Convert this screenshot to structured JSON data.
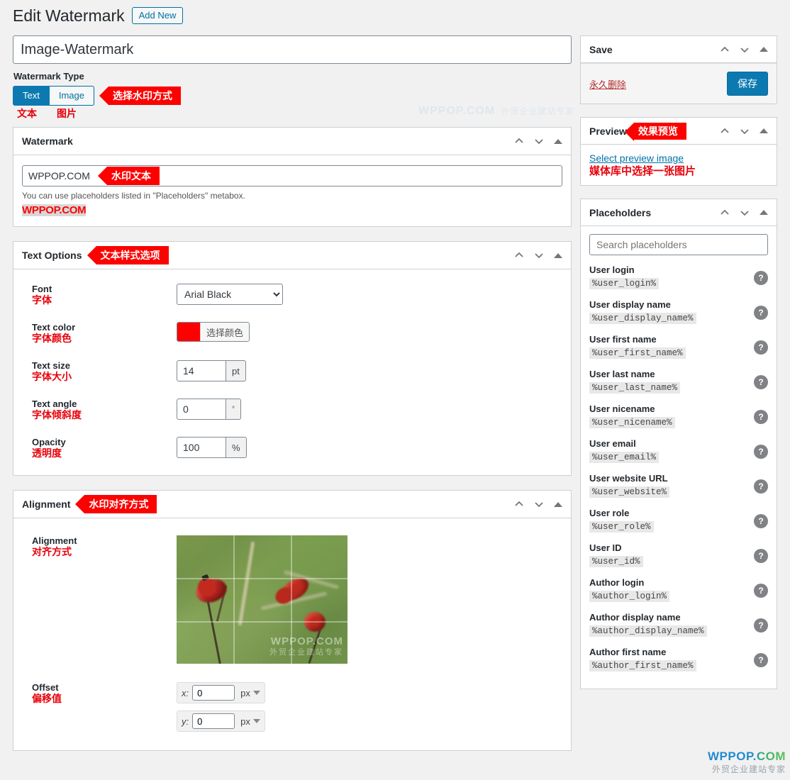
{
  "header": {
    "title": "Edit Watermark",
    "add_new_label": "Add New"
  },
  "title_field": {
    "value": "Image-Watermark"
  },
  "watermark_type": {
    "label": "Watermark Type",
    "tabs": [
      {
        "label": "Text",
        "zh": "文本",
        "active": true
      },
      {
        "label": "Image",
        "zh": "图片",
        "active": false
      }
    ],
    "callout": "选择水印方式"
  },
  "watermark_box": {
    "title": "Watermark",
    "input_value": "WPPOP.COM",
    "callout": "水印文本",
    "hint": "You can use placeholders listed in \"Placeholders\" metabox.",
    "preview_text": "WPPOP.COM"
  },
  "text_options": {
    "title": "Text Options",
    "callout": "文本样式选项",
    "rows": [
      {
        "en": "Font",
        "zh": "字体",
        "value": "Arial Black",
        "unit": ""
      },
      {
        "en": "Text color",
        "zh": "字体颜色",
        "value": "#FF0000",
        "unit": "",
        "button": "选择颜色"
      },
      {
        "en": "Text size",
        "zh": "字体大小",
        "value": "14",
        "unit": "pt"
      },
      {
        "en": "Text angle",
        "zh": "字体倾斜度",
        "value": "0",
        "unit": "°"
      },
      {
        "en": "Opacity",
        "zh": "透明度",
        "value": "100",
        "unit": "%"
      }
    ],
    "font_options": [
      "Arial Black"
    ]
  },
  "alignment_box": {
    "title": "Alignment",
    "callout": "水印对齐方式",
    "align_label_en": "Alignment",
    "align_label_zh": "对齐方式",
    "offset_label_en": "Offset",
    "offset_label_zh": "偏移值",
    "offset_x": {
      "axis": "x:",
      "value": "0",
      "unit": "px"
    },
    "offset_y": {
      "axis": "y:",
      "value": "0",
      "unit": "px"
    },
    "image_watermark_line1": "WPPOP.COM",
    "image_watermark_line2": "外贸企业建站专家"
  },
  "save_panel": {
    "title": "Save",
    "delete_label": "永久删除",
    "save_label": "保存"
  },
  "preview_panel": {
    "title": "Preview",
    "callout": "效果预览",
    "link": "Select preview image",
    "zh": "媒体库中选择一张图片"
  },
  "placeholders_panel": {
    "title": "Placeholders",
    "search_placeholder": "Search placeholders",
    "help_glyph": "?",
    "items": [
      {
        "name": "User login",
        "code": "%user_login%"
      },
      {
        "name": "User display name",
        "code": "%user_display_name%"
      },
      {
        "name": "User first name",
        "code": "%user_first_name%"
      },
      {
        "name": "User last name",
        "code": "%user_last_name%"
      },
      {
        "name": "User nicename",
        "code": "%user_nicename%"
      },
      {
        "name": "User email",
        "code": "%user_email%"
      },
      {
        "name": "User website URL",
        "code": "%user_website%"
      },
      {
        "name": "User role",
        "code": "%user_role%"
      },
      {
        "name": "User ID",
        "code": "%user_id%"
      },
      {
        "name": "Author login",
        "code": "%author_login%"
      },
      {
        "name": "Author display name",
        "code": "%author_display_name%"
      },
      {
        "name": "Author first name",
        "code": "%author_first_name%"
      }
    ]
  },
  "page_watermarks": {
    "top_main": "WPPOP.COM",
    "top_sub": "外贸企业建站专家",
    "bottom_main": "WPPOP.COM",
    "bottom_sub": "外贸企业建站专家"
  },
  "colors": {
    "accent_blue": "#0c7ab0",
    "callout_red": "#fd0000",
    "annotation_red": "#e8000a",
    "text_color_swatch": "#ff0000",
    "delete_red": "#b32d2e"
  }
}
